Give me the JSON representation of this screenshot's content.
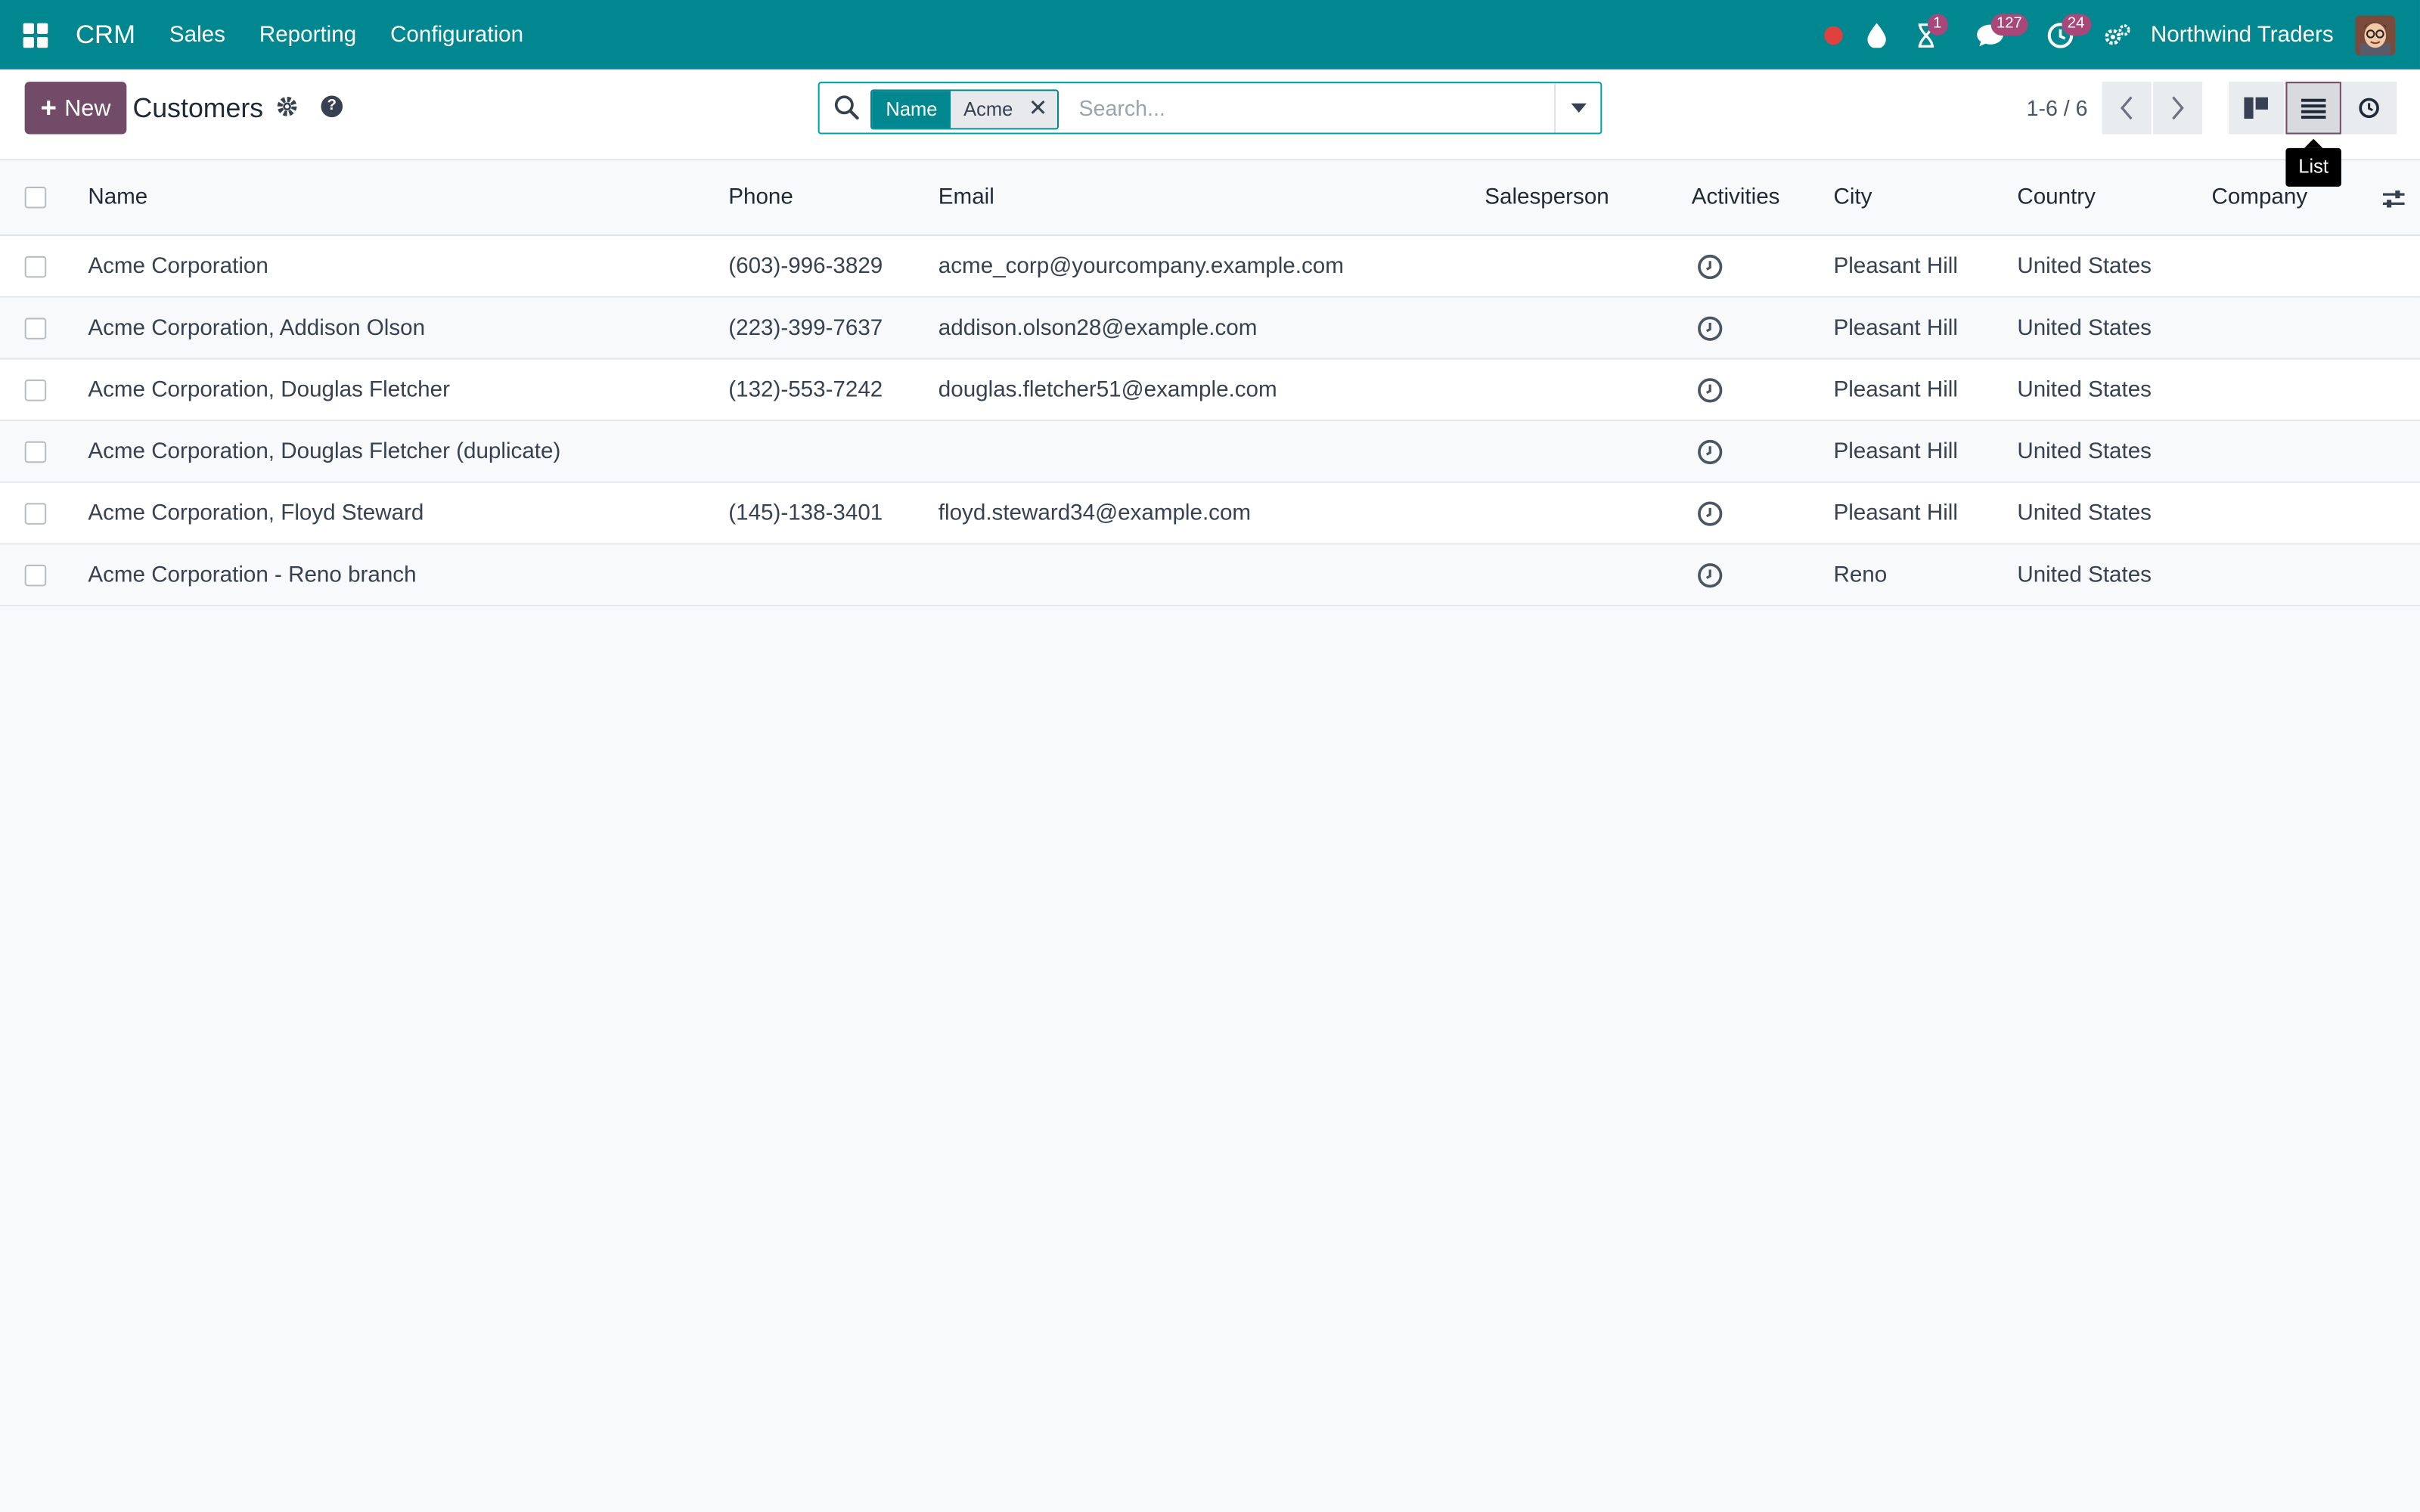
{
  "navbar": {
    "app_name": "CRM",
    "menus": [
      "Sales",
      "Reporting",
      "Configuration"
    ],
    "badges": {
      "activity": "1",
      "messages": "127",
      "timer": "24"
    },
    "company": "Northwind Traders",
    "bg_color": "#018790"
  },
  "control_panel": {
    "new_label": "New",
    "title": "Customers",
    "search": {
      "facet_label": "Name",
      "facet_value": "Acme",
      "placeholder": "Search..."
    },
    "pager": "1-6 / 6",
    "tooltip": "List",
    "accent_color": "#714b67"
  },
  "list": {
    "headers": {
      "name": "Name",
      "phone": "Phone",
      "email": "Email",
      "salesperson": "Salesperson",
      "activities": "Activities",
      "city": "City",
      "country": "Country",
      "company": "Company"
    },
    "rows": [
      {
        "name": "Acme Corporation",
        "phone": "(603)-996-3829",
        "email": "acme_corp@yourcompany.example.com",
        "salesperson": "",
        "city": "Pleasant Hill",
        "country": "United States",
        "company": ""
      },
      {
        "name": "Acme Corporation, Addison Olson",
        "phone": "(223)-399-7637",
        "email": "addison.olson28@example.com",
        "salesperson": "",
        "city": "Pleasant Hill",
        "country": "United States",
        "company": ""
      },
      {
        "name": "Acme Corporation, Douglas Fletcher",
        "phone": "(132)-553-7242",
        "email": "douglas.fletcher51@example.com",
        "salesperson": "",
        "city": "Pleasant Hill",
        "country": "United States",
        "company": ""
      },
      {
        "name": "Acme Corporation, Douglas Fletcher (duplicate)",
        "phone": "",
        "email": "",
        "salesperson": "",
        "city": "Pleasant Hill",
        "country": "United States",
        "company": ""
      },
      {
        "name": "Acme Corporation, Floyd Steward",
        "phone": "(145)-138-3401",
        "email": "floyd.steward34@example.com",
        "salesperson": "",
        "city": "Pleasant Hill",
        "country": "United States",
        "company": ""
      },
      {
        "name": "Acme Corporation - Reno branch",
        "phone": "",
        "email": "",
        "salesperson": "",
        "city": "Reno",
        "country": "United States",
        "company": ""
      }
    ]
  }
}
